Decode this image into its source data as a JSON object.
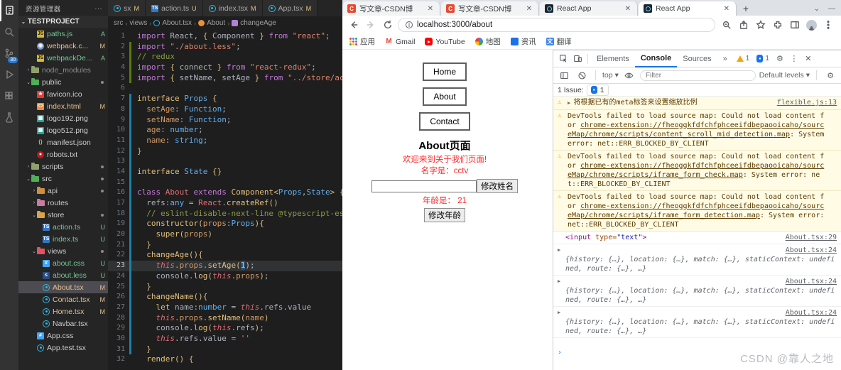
{
  "vscode": {
    "activity": {
      "scm_badge": "30"
    },
    "explorer": {
      "title": "资源管理器",
      "actions": "···",
      "root": "TESTPROJECT",
      "files": [
        {
          "name": "paths.js",
          "icon": "js",
          "icon_name": "js-file-icon",
          "badge": "A",
          "indent": 2,
          "color": "added"
        },
        {
          "name": "webpack.c...",
          "icon": "webpack",
          "icon_name": "webpack-file-icon",
          "badge": "M",
          "indent": 2,
          "color": "mod"
        },
        {
          "name": "webpackDe...",
          "icon": "js",
          "icon_name": "js-file-icon",
          "badge": "A",
          "indent": 2,
          "color": "added"
        },
        {
          "name": "node_modules",
          "folder": "f-gray",
          "icon_name": "folder-icon",
          "arrow": "›",
          "indent": 1,
          "color": "dim"
        },
        {
          "name": "public",
          "folder": "f-green",
          "icon_name": "folder-icon",
          "arrow": "⌄",
          "indent": 1,
          "dot": true
        },
        {
          "name": "favicon.ico",
          "icon": "favicon",
          "icon_name": "favicon-file-icon",
          "indent": 2
        },
        {
          "name": "index.html",
          "icon": "html",
          "icon_name": "html-file-icon",
          "badge": "M",
          "indent": 2,
          "color": "mod"
        },
        {
          "name": "logo192.png",
          "icon": "img",
          "icon_name": "image-file-icon",
          "indent": 2
        },
        {
          "name": "logo512.png",
          "icon": "img",
          "icon_name": "image-file-icon",
          "indent": 2
        },
        {
          "name": "manifest.json",
          "icon": "json",
          "icon_name": "json-file-icon",
          "indent": 2
        },
        {
          "name": "robots.txt",
          "icon": "robots",
          "icon_name": "robots-file-icon",
          "indent": 2
        },
        {
          "name": "scripts",
          "folder": "f-gray",
          "icon_name": "folder-icon",
          "arrow": "›",
          "indent": 1,
          "dot": true
        },
        {
          "name": "src",
          "folder": "f-green",
          "icon_name": "folder-icon",
          "arrow": "⌄",
          "indent": 1,
          "dot": true
        },
        {
          "name": "api",
          "folder": "f-orange",
          "icon_name": "folder-icon",
          "arrow": "›",
          "indent": 2,
          "dot": true
        },
        {
          "name": "routes",
          "folder": "f-pink",
          "icon_name": "folder-icon",
          "arrow": "›",
          "indent": 2
        },
        {
          "name": "store",
          "folder": "f-tan",
          "icon_name": "folder-icon",
          "arrow": "⌄",
          "indent": 2,
          "dot": true
        },
        {
          "name": "action.ts",
          "icon": "ts",
          "icon_name": "ts-file-icon",
          "badge": "U",
          "indent": 3,
          "color": "added"
        },
        {
          "name": "index.ts",
          "icon": "ts",
          "icon_name": "ts-file-icon",
          "badge": "U",
          "indent": 3,
          "color": "added"
        },
        {
          "name": "views",
          "folder": "f-red",
          "icon_name": "folder-icon",
          "arrow": "⌄",
          "indent": 2,
          "dot": true
        },
        {
          "name": "about.css",
          "icon": "css",
          "icon_name": "css-file-icon",
          "badge": "U",
          "indent": 3,
          "color": "added"
        },
        {
          "name": "about.less",
          "icon": "less",
          "icon_name": "less-file-icon",
          "badge": "U",
          "indent": 3,
          "color": "added"
        },
        {
          "name": "About.tsx",
          "icon": "react",
          "icon_name": "react-file-icon",
          "badge": "M",
          "indent": 3,
          "color": "mod",
          "selected": true
        },
        {
          "name": "Contact.tsx",
          "icon": "react",
          "icon_name": "react-file-icon",
          "badge": "M",
          "indent": 3,
          "color": "mod"
        },
        {
          "name": "Home.tsx",
          "icon": "react",
          "icon_name": "react-file-icon",
          "badge": "M",
          "indent": 3,
          "color": "mod"
        },
        {
          "name": "Navbar.tsx",
          "icon": "react",
          "icon_name": "react-file-icon",
          "indent": 3
        },
        {
          "name": "App.css",
          "icon": "css",
          "icon_name": "css-file-icon",
          "indent": 2
        },
        {
          "name": "App.test.tsx",
          "icon": "react",
          "icon_name": "react-file-icon",
          "indent": 2
        }
      ]
    },
    "tabs": [
      {
        "label": "sx",
        "badge": "M",
        "icon": "react"
      },
      {
        "label": "action.ts",
        "badge": "U",
        "icon": "ts"
      },
      {
        "label": "index.tsx",
        "badge": "M",
        "icon": "react"
      },
      {
        "label": "App.tsx",
        "badge": "M",
        "icon": "react"
      }
    ],
    "breadcrumb": [
      {
        "label": "src"
      },
      {
        "label": "views"
      },
      {
        "label": "About.tsx",
        "icon": "bc-react"
      },
      {
        "label": "About",
        "icon": "bc-class"
      },
      {
        "label": "changeAge",
        "icon": "bc-method"
      }
    ],
    "code": {
      "active_line": 23,
      "git_added": [
        2,
        5
      ],
      "git_modified": [
        7,
        31
      ],
      "lines": [
        [
          [
            "k",
            "import"
          ],
          [
            "t",
            " React, "
          ],
          [
            "p",
            "{"
          ],
          [
            "t",
            " Component "
          ],
          [
            "p",
            "}"
          ],
          [
            "k",
            " from "
          ],
          [
            "s",
            "\"react\""
          ],
          [
            "t",
            ";"
          ]
        ],
        [
          [
            "k",
            "import"
          ],
          [
            "s",
            " \"./about.less\""
          ],
          [
            "t",
            ";"
          ]
        ],
        [
          [
            "c",
            "// redux"
          ]
        ],
        [
          [
            "k",
            "import"
          ],
          [
            "t",
            " "
          ],
          [
            "p",
            "{"
          ],
          [
            "t",
            " connect "
          ],
          [
            "p",
            "}"
          ],
          [
            "k",
            " from "
          ],
          [
            "s",
            "\"react-redux\""
          ],
          [
            "t",
            ";"
          ]
        ],
        [
          [
            "k",
            "import"
          ],
          [
            "t",
            " "
          ],
          [
            "p",
            "{"
          ],
          [
            "t",
            " setName, setAge "
          ],
          [
            "p",
            "}"
          ],
          [
            "k",
            " from "
          ],
          [
            "s",
            "\"../store/act"
          ]
        ],
        [],
        [
          [
            "kw2",
            "interface"
          ],
          [
            "ty",
            " Props "
          ],
          [
            "p",
            "{"
          ]
        ],
        [
          [
            "prop",
            "  setAge"
          ],
          [
            "t",
            ": "
          ],
          [
            "ty",
            "Function"
          ],
          [
            "t",
            ";"
          ]
        ],
        [
          [
            "prop",
            "  setName"
          ],
          [
            "t",
            ": "
          ],
          [
            "ty",
            "Function"
          ],
          [
            "t",
            ";"
          ]
        ],
        [
          [
            "prop",
            "  age"
          ],
          [
            "t",
            ": "
          ],
          [
            "ty",
            "number"
          ],
          [
            "t",
            ";"
          ]
        ],
        [
          [
            "prop",
            "  name"
          ],
          [
            "t",
            ": "
          ],
          [
            "ty",
            "string"
          ],
          [
            "t",
            ";"
          ]
        ],
        [
          [
            "p",
            "}"
          ]
        ],
        [],
        [
          [
            "kw2",
            "interface"
          ],
          [
            "ty",
            " State "
          ],
          [
            "p",
            "{}"
          ]
        ],
        [],
        [
          [
            "k",
            "class"
          ],
          [
            "cls",
            " About "
          ],
          [
            "k",
            "extends"
          ],
          [
            "fn",
            " Component"
          ],
          [
            "p",
            "<"
          ],
          [
            "ty",
            "Props"
          ],
          [
            "t",
            ","
          ],
          [
            "ty",
            "State"
          ],
          [
            "p",
            "> "
          ],
          [
            "p",
            "{"
          ]
        ],
        [
          [
            "t",
            "  refs:"
          ],
          [
            "ty",
            "any"
          ],
          [
            "t",
            " = "
          ],
          [
            "cls",
            "React"
          ],
          [
            "t",
            "."
          ],
          [
            "fn",
            "createRef"
          ],
          [
            "p",
            "()"
          ]
        ],
        [
          [
            "c",
            "  // eslint-disable-next-line @typescript-esl"
          ]
        ],
        [
          [
            "kw2",
            "  constructor"
          ],
          [
            "p",
            "("
          ],
          [
            "v",
            "props"
          ],
          [
            "t",
            ":"
          ],
          [
            "ty",
            "Props"
          ],
          [
            "p",
            "){"
          ]
        ],
        [
          [
            "fn",
            "    super"
          ],
          [
            "p",
            "("
          ],
          [
            "v",
            "props"
          ],
          [
            "p",
            ")"
          ]
        ],
        [
          [
            "p",
            "  }"
          ]
        ],
        [
          [
            "fn",
            "  changeAge"
          ],
          [
            "p",
            "(){"
          ]
        ],
        [
          [
            "th",
            "    this"
          ],
          [
            "t",
            "."
          ],
          [
            "v",
            "props"
          ],
          [
            "t",
            "."
          ],
          [
            "fn",
            "setAge"
          ],
          [
            "p",
            "("
          ],
          [
            "sel",
            "1"
          ],
          [
            "p",
            ")"
          ],
          [
            "t",
            ";"
          ]
        ],
        [
          [
            "t",
            "    console."
          ],
          [
            "fn",
            "log"
          ],
          [
            "p",
            "("
          ],
          [
            "th",
            "this"
          ],
          [
            "t",
            "."
          ],
          [
            "v",
            "props"
          ],
          [
            "p",
            ")"
          ],
          [
            "t",
            ";"
          ]
        ],
        [
          [
            "p",
            "  }"
          ]
        ],
        [
          [
            "fn",
            "  changeName"
          ],
          [
            "p",
            "(){"
          ]
        ],
        [
          [
            "kw2",
            "    let"
          ],
          [
            "t",
            " name:"
          ],
          [
            "ty",
            "number"
          ],
          [
            "t",
            " = "
          ],
          [
            "th",
            "this"
          ],
          [
            "t",
            ".refs.value"
          ]
        ],
        [
          [
            "th",
            "    this"
          ],
          [
            "t",
            "."
          ],
          [
            "v",
            "props"
          ],
          [
            "t",
            "."
          ],
          [
            "fn",
            "setName"
          ],
          [
            "p",
            "("
          ],
          [
            "v",
            "name"
          ],
          [
            "p",
            ")"
          ]
        ],
        [
          [
            "t",
            "    console."
          ],
          [
            "fn",
            "log"
          ],
          [
            "p",
            "("
          ],
          [
            "th",
            "this"
          ],
          [
            "t",
            ".refs"
          ],
          [
            "p",
            ")"
          ],
          [
            "t",
            ";"
          ]
        ],
        [
          [
            "th",
            "    this"
          ],
          [
            "t",
            ".refs.value = "
          ],
          [
            "s",
            "''"
          ]
        ],
        [
          [
            "p",
            "  }"
          ]
        ],
        [
          [
            "fn",
            "  render"
          ],
          [
            "p",
            "()"
          ],
          [
            "t",
            " "
          ],
          [
            "p",
            "{"
          ]
        ]
      ]
    }
  },
  "browser": {
    "tabs": [
      {
        "title": "写文章-CSDN博",
        "icon": "csdn",
        "close": "✕"
      },
      {
        "title": "写文章-CSDN博",
        "icon": "csdn",
        "close": "✕"
      },
      {
        "title": "React App",
        "icon": "react",
        "close": "✕"
      },
      {
        "title": "React App",
        "icon": "react",
        "close": "✕",
        "active": true
      }
    ],
    "new_tab": "+",
    "url": "localhost:3000/about",
    "bookmarks": [
      {
        "label": "应用",
        "icon": "apps"
      },
      {
        "label": "Gmail",
        "icon": "gmail"
      },
      {
        "label": "YouTube",
        "icon": "yt"
      },
      {
        "label": "地图",
        "icon": "map"
      },
      {
        "label": "资讯",
        "icon": "news"
      },
      {
        "label": "翻译",
        "icon": "tr"
      }
    ],
    "page": {
      "nav_buttons": [
        "Home",
        "About",
        "Contact"
      ],
      "heading": "About页面",
      "welcome": "欢迎来到关于我们页面!",
      "name_line": "名字是：cctv",
      "change_name_button": "修改姓名",
      "age_line": "年龄是： 21",
      "change_age_button": "修改年龄"
    },
    "devtools": {
      "tabs": [
        {
          "label": "Elements"
        },
        {
          "label": "Console",
          "active": true
        },
        {
          "label": "Sources"
        },
        {
          "label": "»"
        }
      ],
      "warning_count": "1",
      "message_count": "1",
      "context_selector": "top",
      "filter_placeholder": "Filter",
      "levels_selector": "Default levels",
      "issue_label": "1 Issue:",
      "issue_count": "1",
      "messages": [
        {
          "kind": "warn",
          "expand": true,
          "text": "将根据已有的meta标签来设置缩放比例",
          "link": "flexible.js:13"
        },
        {
          "kind": "warn",
          "segments": [
            {
              "text": "DevTools failed to load source map: Could not load content for "
            },
            {
              "text": "chrome-extension://fheoggkfdfchfphceeifdbepaooicaho/sourceMap/chrome/scripts/content_scroll_mid_detection.map",
              "underline": true
            },
            {
              "text": ": System error: net::ERR_BLOCKED_BY_CLIENT"
            }
          ]
        },
        {
          "kind": "warn",
          "segments": [
            {
              "text": "DevTools failed to load source map: Could not load content for "
            },
            {
              "text": "chrome-extension://fheoggkfdfchfphceeifdbepaooicaho/sourceMap/chrome/scripts/iframe_form_check.map",
              "underline": true
            },
            {
              "text": ": System error: net::ERR_BLOCKED_BY_CLIENT"
            }
          ]
        },
        {
          "kind": "warn",
          "segments": [
            {
              "text": "DevTools failed to load source map: Could not load content for "
            },
            {
              "text": "chrome-extension://fheoggkfdfchfphceeifdbepaooicaho/sourceMap/chrome/scripts/iframe_form_detection.map",
              "underline": true
            },
            {
              "text": ": System error: net::ERR_BLOCKED_BY_CLIENT"
            }
          ]
        },
        {
          "kind": "element",
          "tag": "<input",
          "attr": " type=",
          "value": "\"text\"",
          "end": ">",
          "link": "About.tsx:29"
        },
        {
          "kind": "object",
          "preview": "{history: {…}, location: {…}, match: {…}, staticContext: undefined, route: {…}, …}",
          "link": "About.tsx:24"
        },
        {
          "kind": "object",
          "preview": "{history: {…}, location: {…}, match: {…}, staticContext: undefined, route: {…}, …}",
          "link": "About.tsx:24"
        },
        {
          "kind": "object",
          "preview": "{history: {…}, location: {…}, match: {…}, staticContext: undefined, route: {…}, …}",
          "link": "About.tsx:24"
        }
      ],
      "prompt": "›"
    }
  },
  "watermark": "CSDN @靠人之地"
}
